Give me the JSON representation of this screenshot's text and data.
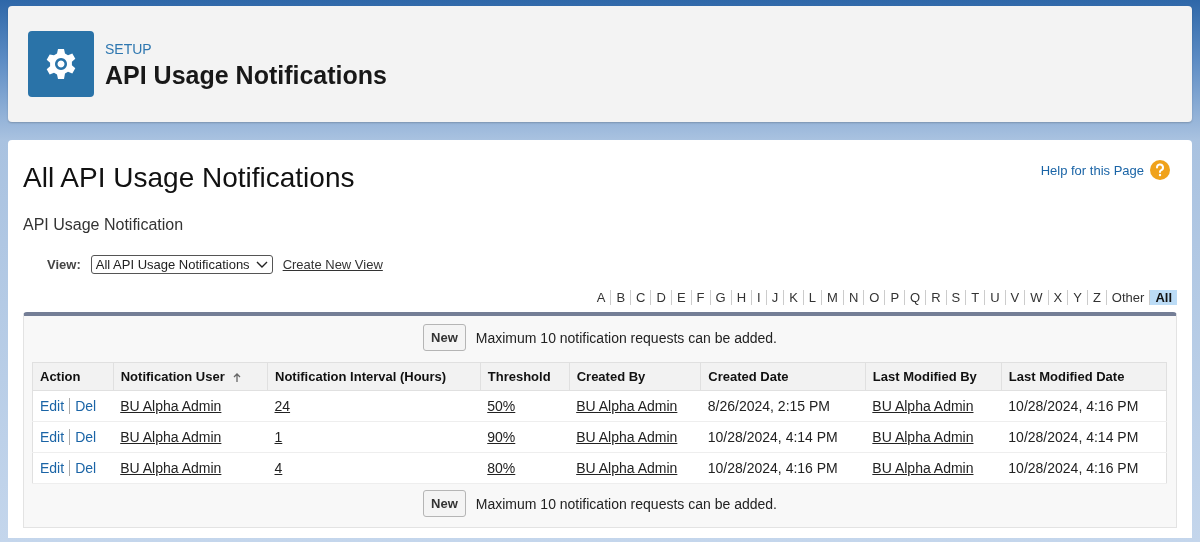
{
  "header": {
    "eyebrow": "SETUP",
    "title": "API Usage Notifications"
  },
  "page": {
    "title": "All API Usage Notifications",
    "help_link": "Help for this Page",
    "subtitle": "API Usage Notification"
  },
  "view": {
    "label": "View:",
    "selected_option": "All API Usage Notifications",
    "create_link": "Create New View"
  },
  "filter_letters": [
    {
      "label": "A",
      "selected": false
    },
    {
      "label": "B",
      "selected": false
    },
    {
      "label": "C",
      "selected": false
    },
    {
      "label": "D",
      "selected": false
    },
    {
      "label": "E",
      "selected": false
    },
    {
      "label": "F",
      "selected": false
    },
    {
      "label": "G",
      "selected": false
    },
    {
      "label": "H",
      "selected": false
    },
    {
      "label": "I",
      "selected": false
    },
    {
      "label": "J",
      "selected": false
    },
    {
      "label": "K",
      "selected": false
    },
    {
      "label": "L",
      "selected": false
    },
    {
      "label": "M",
      "selected": false
    },
    {
      "label": "N",
      "selected": false
    },
    {
      "label": "O",
      "selected": false
    },
    {
      "label": "P",
      "selected": false
    },
    {
      "label": "Q",
      "selected": false
    },
    {
      "label": "R",
      "selected": false
    },
    {
      "label": "S",
      "selected": false
    },
    {
      "label": "T",
      "selected": false
    },
    {
      "label": "U",
      "selected": false
    },
    {
      "label": "V",
      "selected": false
    },
    {
      "label": "W",
      "selected": false
    },
    {
      "label": "X",
      "selected": false
    },
    {
      "label": "Y",
      "selected": false
    },
    {
      "label": "Z",
      "selected": false
    },
    {
      "label": "Other",
      "selected": false
    },
    {
      "label": "All",
      "selected": true
    }
  ],
  "top_bar": {
    "button": "New",
    "message": "Maximum 10 notification requests can be added."
  },
  "table": {
    "columns": [
      {
        "label": "Action",
        "sorted": false
      },
      {
        "label": "Notification User",
        "sorted": true
      },
      {
        "label": "Notification Interval (Hours)",
        "sorted": false
      },
      {
        "label": "Threshold",
        "sorted": false
      },
      {
        "label": "Created By",
        "sorted": false
      },
      {
        "label": "Created Date",
        "sorted": false
      },
      {
        "label": "Last Modified By",
        "sorted": false
      },
      {
        "label": "Last Modified Date",
        "sorted": false
      }
    ],
    "rows": [
      {
        "cells": [
          {
            "kind": "actions",
            "links": [
              "Edit",
              "Del"
            ]
          },
          {
            "text": "BU Alpha Admin",
            "kind": "link"
          },
          {
            "text": "24",
            "kind": "link"
          },
          {
            "text": "50%",
            "kind": "link"
          },
          {
            "text": "BU Alpha Admin",
            "kind": "link"
          },
          {
            "text": "8/26/2024, 2:15 PM",
            "kind": "text"
          },
          {
            "text": "BU Alpha Admin",
            "kind": "link"
          },
          {
            "text": "10/28/2024, 4:16 PM",
            "kind": "text"
          }
        ]
      },
      {
        "cells": [
          {
            "kind": "actions",
            "links": [
              "Edit",
              "Del"
            ]
          },
          {
            "text": "BU Alpha Admin",
            "kind": "link"
          },
          {
            "text": "1",
            "kind": "link"
          },
          {
            "text": "90%",
            "kind": "link"
          },
          {
            "text": "BU Alpha Admin",
            "kind": "link"
          },
          {
            "text": "10/28/2024, 4:14 PM",
            "kind": "text"
          },
          {
            "text": "BU Alpha Admin",
            "kind": "link"
          },
          {
            "text": "10/28/2024, 4:14 PM",
            "kind": "text"
          }
        ]
      },
      {
        "cells": [
          {
            "kind": "actions",
            "links": [
              "Edit",
              "Del"
            ]
          },
          {
            "text": "BU Alpha Admin",
            "kind": "link"
          },
          {
            "text": "4",
            "kind": "link"
          },
          {
            "text": "80%",
            "kind": "link"
          },
          {
            "text": "BU Alpha Admin",
            "kind": "link"
          },
          {
            "text": "10/28/2024, 4:16 PM",
            "kind": "text"
          },
          {
            "text": "BU Alpha Admin",
            "kind": "link"
          },
          {
            "text": "10/28/2024, 4:16 PM",
            "kind": "text"
          }
        ]
      }
    ]
  },
  "bottom_bar": {
    "button": "New",
    "message": "Maximum 10 notification requests can be added."
  }
}
